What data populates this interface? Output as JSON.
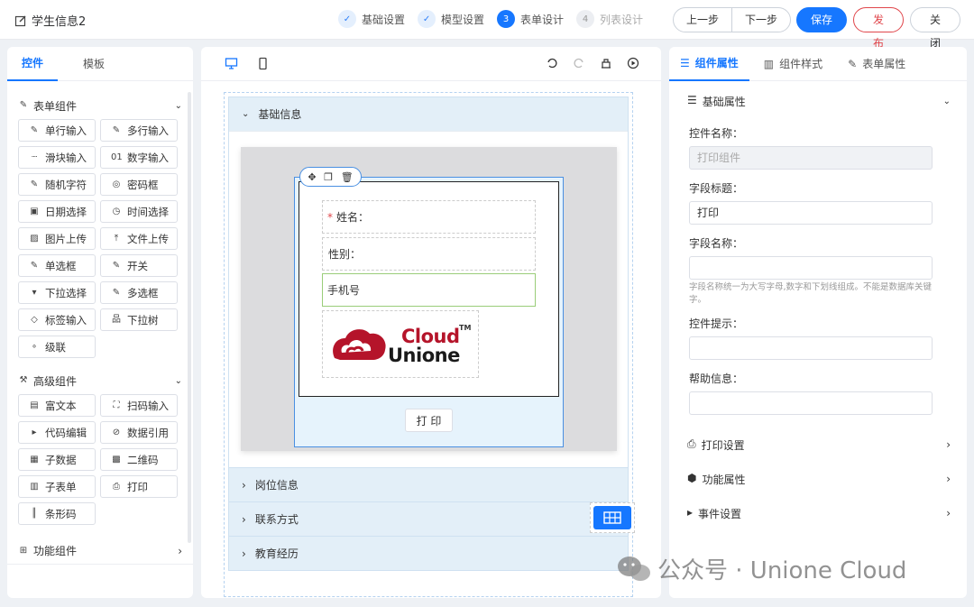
{
  "header": {
    "title": "学生信息2",
    "steps": [
      {
        "label": "基础设置",
        "state": "done"
      },
      {
        "label": "模型设置",
        "state": "done"
      },
      {
        "num": "3",
        "label": "表单设计",
        "state": "active"
      },
      {
        "num": "4",
        "label": "列表设计",
        "state": "todo"
      }
    ],
    "prev": "上一步",
    "next": "下一步",
    "save": "保存",
    "publish": "发 布",
    "close": "关 闭"
  },
  "left": {
    "tabs": [
      "控件",
      "模板"
    ],
    "form_group": "表单组件",
    "form_items": [
      {
        "icon": "✎",
        "name": "pencil-icon",
        "label": "单行输入"
      },
      {
        "icon": "✎",
        "name": "pencil-icon",
        "label": "多行输入"
      },
      {
        "icon": "┈",
        "name": "slider-icon",
        "label": "滑块输入"
      },
      {
        "icon": "01",
        "name": "number-icon",
        "label": "数字输入"
      },
      {
        "icon": "✎",
        "name": "pencil-icon",
        "label": "随机字符"
      },
      {
        "icon": "◎",
        "name": "eye-off-icon",
        "label": "密码框"
      },
      {
        "icon": "▣",
        "name": "calendar-icon",
        "label": "日期选择"
      },
      {
        "icon": "◷",
        "name": "clock-icon",
        "label": "时间选择"
      },
      {
        "icon": "▨",
        "name": "image-icon",
        "label": "图片上传"
      },
      {
        "icon": "⤒",
        "name": "upload-icon",
        "label": "文件上传"
      },
      {
        "icon": "✎",
        "name": "pencil-icon",
        "label": "单选框"
      },
      {
        "icon": "✎",
        "name": "pencil-icon",
        "label": "开关"
      },
      {
        "icon": "▾",
        "name": "select-icon",
        "label": "下拉选择"
      },
      {
        "icon": "✎",
        "name": "pencil-icon",
        "label": "多选框"
      },
      {
        "icon": "◇",
        "name": "tag-icon",
        "label": "标签输入"
      },
      {
        "icon": "品",
        "name": "tree-icon",
        "label": "下拉树"
      },
      {
        "icon": "∘",
        "name": "cascade-icon",
        "label": "级联"
      }
    ],
    "adv_group": "高级组件",
    "adv_items": [
      {
        "icon": "▤",
        "name": "richtext-icon",
        "label": "富文本"
      },
      {
        "icon": "⛶",
        "name": "scan-icon",
        "label": "扫码输入"
      },
      {
        "icon": "▸",
        "name": "code-icon",
        "label": "代码编辑"
      },
      {
        "icon": "⊘",
        "name": "link-icon",
        "label": "数据引用"
      },
      {
        "icon": "▦",
        "name": "table-icon",
        "label": "子数据"
      },
      {
        "icon": "▩",
        "name": "qrcode-icon",
        "label": "二维码"
      },
      {
        "icon": "▥",
        "name": "subform-icon",
        "label": "子表单"
      },
      {
        "icon": "⎙",
        "name": "printer-icon",
        "label": "打印"
      },
      {
        "icon": "║",
        "name": "barcode-icon",
        "label": "条形码"
      }
    ],
    "func_group": "功能组件"
  },
  "canvas": {
    "section1": "基础信息",
    "fields": {
      "name": "姓名：",
      "required": "*",
      "gender": "性别：",
      "phone": "手机号"
    },
    "logo_top": "Cloud",
    "logo_bottom": "Unione",
    "logo_tm": "TM",
    "print_btn": "打 印",
    "sections": [
      "岗位信息",
      "联系方式",
      "教育经历"
    ]
  },
  "right": {
    "tabs": [
      "组件属性",
      "组件样式",
      "表单属性"
    ],
    "basic": "基础属性",
    "ctrl_name_label": "控件名称：",
    "ctrl_name_value": "打印组件",
    "field_title_label": "字段标题：",
    "field_title_value": "打印",
    "field_name_label": "字段名称：",
    "field_name_value": "",
    "field_name_hint": "字段名称统一为大写字母,数字和下划线组成。不能是数据库关键字。",
    "ctrl_tip_label": "控件提示：",
    "help_label": "帮助信息：",
    "rows": [
      "打印设置",
      "功能属性",
      "事件设置"
    ]
  },
  "watermark": "公众号 · Unione Cloud",
  "colors": {
    "primary": "#1677ff",
    "danger": "#e0464b",
    "logo_red": "#b5142a"
  }
}
